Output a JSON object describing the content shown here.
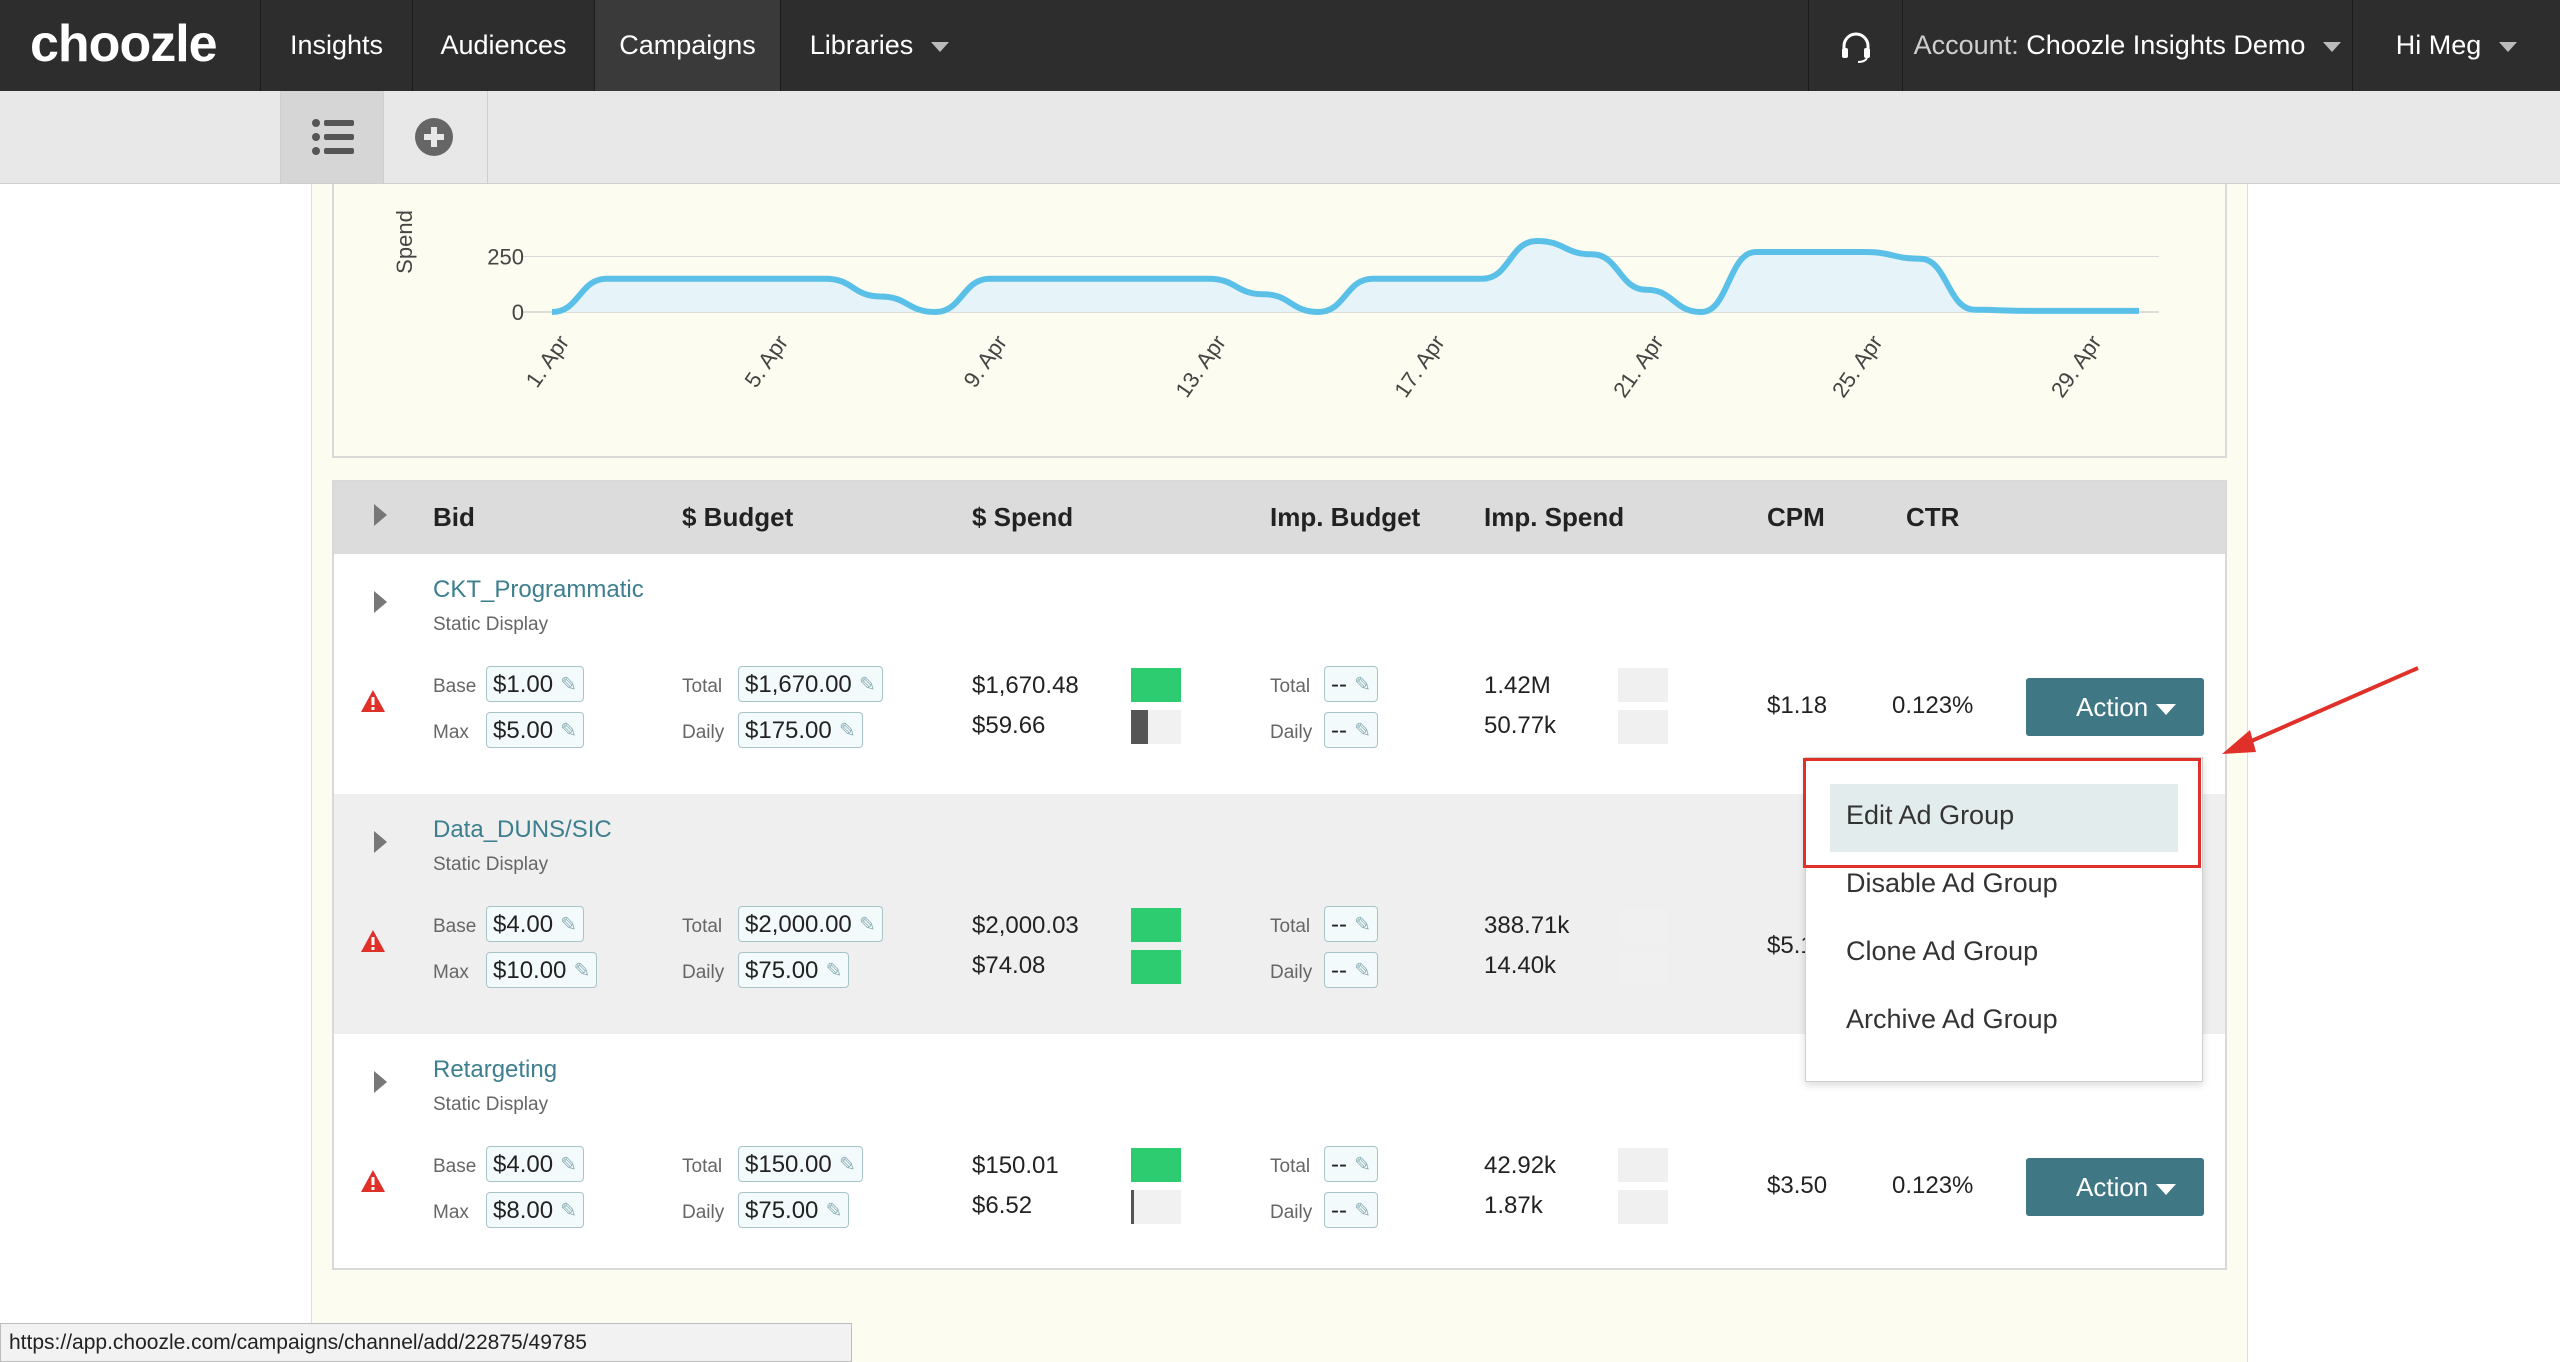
{
  "nav": {
    "logo": "choozle",
    "items": [
      "Insights",
      "Audiences",
      "Campaigns",
      "Libraries"
    ],
    "account_label": "Account:",
    "account_name": "Choozle Insights Demo",
    "user": "Hi Meg"
  },
  "chart_data": {
    "type": "area",
    "ylabel": "Spend",
    "yticks": [
      "250",
      "0"
    ],
    "xticks": [
      "1. Apr",
      "5. Apr",
      "9. Apr",
      "13. Apr",
      "17. Apr",
      "21. Apr",
      "25. Apr",
      "29. Apr"
    ],
    "color": "#5bc0e8",
    "x": [
      1,
      2,
      3,
      4,
      5,
      6,
      7,
      8,
      9,
      10,
      11,
      12,
      13,
      14,
      15,
      16,
      17,
      18,
      19,
      20,
      21,
      22,
      23,
      24,
      25,
      26,
      27,
      28,
      29,
      30
    ],
    "values": [
      0,
      150,
      150,
      150,
      150,
      150,
      70,
      0,
      150,
      150,
      150,
      150,
      150,
      80,
      0,
      150,
      150,
      150,
      320,
      260,
      100,
      0,
      270,
      270,
      270,
      240,
      10,
      5,
      5,
      5
    ]
  },
  "table": {
    "headers": [
      "Bid",
      "$ Budget",
      "$ Spend",
      "Imp. Budget",
      "Imp. Spend",
      "CPM",
      "CTR"
    ],
    "labels": {
      "base": "Base",
      "max": "Max",
      "total": "Total",
      "daily": "Daily"
    },
    "rows": [
      {
        "name": "CKT_Programmatic",
        "type": "Static Display",
        "base": "$1.00",
        "max": "$5.00",
        "budget_total": "$1,670.00",
        "budget_daily": "$175.00",
        "spend_total": "$1,670.48",
        "spend_daily": "$59.66",
        "imp_total": "--",
        "imp_daily": "--",
        "imp_spend_total": "1.42M",
        "imp_spend_daily": "50.77k",
        "cpm": "$1.18",
        "ctr": "0.123%",
        "action": "Action"
      },
      {
        "name": "Data_DUNS/SIC",
        "type": "Static Display",
        "base": "$4.00",
        "max": "$10.00",
        "budget_total": "$2,000.00",
        "budget_daily": "$75.00",
        "spend_total": "$2,000.03",
        "spend_daily": "$74.08",
        "imp_total": "--",
        "imp_daily": "--",
        "imp_spend_total": "388.71k",
        "imp_spend_daily": "14.40k",
        "cpm": "$5.1",
        "ctr": "",
        "action": ""
      },
      {
        "name": "Retargeting",
        "type": "Static Display",
        "base": "$4.00",
        "max": "$8.00",
        "budget_total": "$150.00",
        "budget_daily": "$75.00",
        "spend_total": "$150.01",
        "spend_daily": "$6.52",
        "imp_total": "--",
        "imp_daily": "--",
        "imp_spend_total": "42.92k",
        "imp_spend_daily": "1.87k",
        "cpm": "$3.50",
        "ctr": "0.123%",
        "action": "Action"
      }
    ]
  },
  "menu": {
    "items": [
      "Edit Ad Group",
      "Disable Ad Group",
      "Clone Ad Group",
      "Archive Ad Group"
    ]
  },
  "status_url": "https://app.choozle.com/campaigns/channel/add/22875/49785",
  "colors": {
    "accent": "#3f7784",
    "nav_bg": "#2d2d2d",
    "progress_green": "#2ecc71",
    "alert_red": "#e0302a"
  }
}
